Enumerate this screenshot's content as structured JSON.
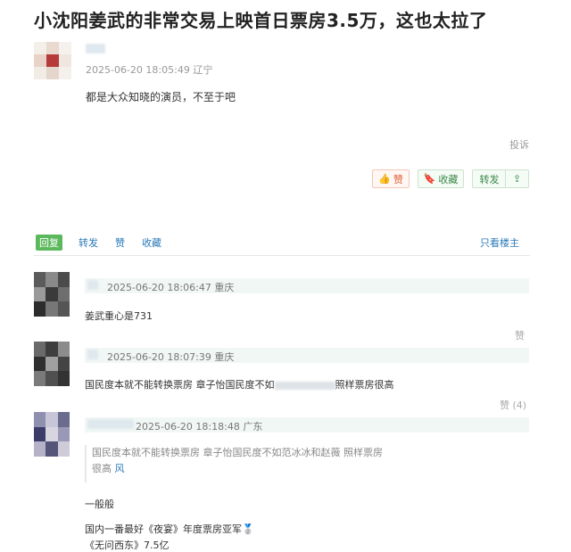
{
  "page": {
    "title": "小沈阳姜武的非常交易上映首日票房3.5万，这也太拉了"
  },
  "post": {
    "timestamp": "2025-06-20 18:05:49 辽宁",
    "text": "都是大众知晓的演员，不至于吧",
    "report_label": "投诉",
    "like_label": "赞",
    "favorite_label": "收藏",
    "forward_label": "转发"
  },
  "tabs": {
    "reply": "回复",
    "forward": "转发",
    "like": "赞",
    "favorite": "收藏",
    "owner_only": "只看楼主"
  },
  "comments": [
    {
      "timestamp": "2025-06-20 18:06:47 重庆",
      "text": "姜武重心是731",
      "like_label": "赞"
    },
    {
      "timestamp": "2025-06-20 18:07:39 重庆",
      "text_before": "国民度本就不能转换票房 章子怡国民度不如",
      "text_after": "照样票房很高",
      "like_label": "赞 (4)"
    },
    {
      "timestamp": "2025-06-20 18:18:48 广东",
      "quote_line1": "国民度本就不能转换票房 章子怡国民度不如范冰冰和赵薇 照样票房",
      "quote_line2": "很高",
      "quote_author": "风",
      "line1": "一般般",
      "line2": "国内一番最好《夜宴》年度票房亚军🥈",
      "line3": "《无问西东》7.5亿"
    }
  ],
  "colors": {
    "link": "#2a7ab8",
    "reply_green": "#5cb85c",
    "like_orange": "#e0613c"
  },
  "icons": [
    "thumb-icon",
    "bookmark-icon",
    "share-icon",
    "medal-icon"
  ]
}
